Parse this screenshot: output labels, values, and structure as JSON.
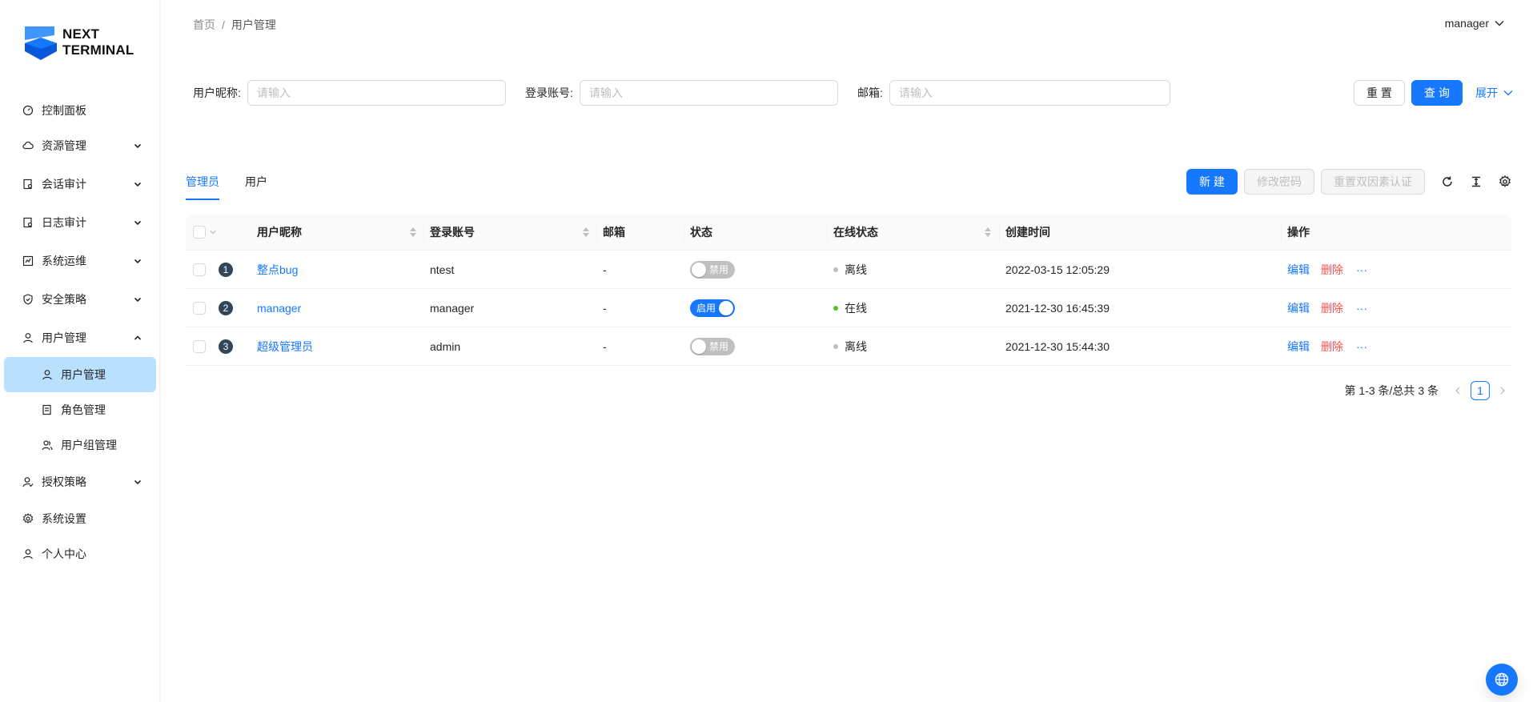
{
  "logo": {
    "line1": "NEXT",
    "line2": "TERMINAL"
  },
  "sidebar": {
    "items": [
      {
        "label": "控制面板",
        "icon": "dashboard-icon",
        "has_children": false
      },
      {
        "label": "资源管理",
        "icon": "cloud-icon",
        "has_children": true
      },
      {
        "label": "会话审计",
        "icon": "audit-icon",
        "has_children": true
      },
      {
        "label": "日志审计",
        "icon": "log-icon",
        "has_children": true
      },
      {
        "label": "系统运维",
        "icon": "ops-icon",
        "has_children": true
      },
      {
        "label": "安全策略",
        "icon": "shield-icon",
        "has_children": true
      },
      {
        "label": "用户管理",
        "icon": "user-icon",
        "has_children": true,
        "expanded": true
      }
    ],
    "sub_items": [
      {
        "label": "用户管理",
        "icon": "user-icon",
        "active": true
      },
      {
        "label": "角色管理",
        "icon": "role-icon",
        "active": false
      },
      {
        "label": "用户组管理",
        "icon": "group-icon",
        "active": false
      }
    ],
    "bottom_items": [
      {
        "label": "授权策略",
        "icon": "auth-icon",
        "has_children": true
      },
      {
        "label": "系统设置",
        "icon": "gear-icon",
        "has_children": false
      },
      {
        "label": "个人中心",
        "icon": "user-icon",
        "has_children": false
      }
    ]
  },
  "header": {
    "breadcrumb": [
      "首页",
      "用户管理"
    ],
    "separator": "/",
    "username": "manager"
  },
  "search": {
    "nickname_label": "用户昵称:",
    "nickname_placeholder": "请输入",
    "account_label": "登录账号:",
    "account_placeholder": "请输入",
    "email_label": "邮箱:",
    "email_placeholder": "请输入",
    "reset_label": "重 置",
    "query_label": "查 询",
    "expand_label": "展开"
  },
  "tabs": [
    {
      "label": "管理员",
      "active": true
    },
    {
      "label": "用户",
      "active": false
    }
  ],
  "toolbar": {
    "new_label": "新 建",
    "change_password_label": "修改密码",
    "reset_2fa_label": "重置双因素认证"
  },
  "table": {
    "columns": {
      "nickname": "用户昵称",
      "account": "登录账号",
      "email": "邮箱",
      "status": "状态",
      "online": "在线状态",
      "created": "创建时间",
      "actions": "操作"
    },
    "rows": [
      {
        "index": "1",
        "nickname": "整点bug",
        "account": "ntest",
        "email": "-",
        "status": "禁用",
        "status_on": false,
        "online": "离线",
        "online_color": "#bfbfbf",
        "created": "2022-03-15 12:05:29"
      },
      {
        "index": "2",
        "nickname": "manager",
        "account": "manager",
        "email": "-",
        "status": "启用",
        "status_on": true,
        "online": "在线",
        "online_color": "#52c41a",
        "created": "2021-12-30 16:45:39"
      },
      {
        "index": "3",
        "nickname": "超级管理员",
        "account": "admin",
        "email": "-",
        "status": "禁用",
        "status_on": false,
        "online": "离线",
        "online_color": "#bfbfbf",
        "created": "2021-12-30 15:44:30"
      }
    ],
    "action_edit": "编辑",
    "action_delete": "删除",
    "action_more": "···"
  },
  "pagination": {
    "total_text": "第 1-3 条/总共 3 条",
    "current_page": "1"
  },
  "colors": {
    "primary": "#1677ff",
    "danger": "#ff4d4f",
    "active_menu_bg": "#bae0ff"
  }
}
